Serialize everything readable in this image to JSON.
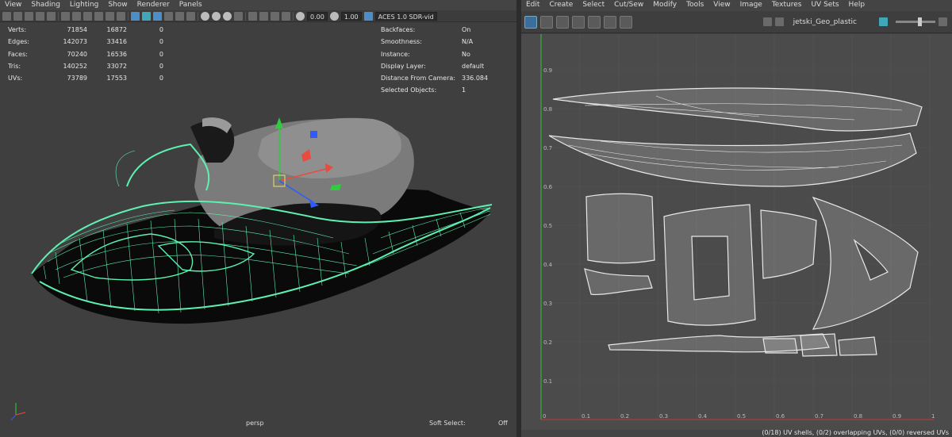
{
  "viewport": {
    "menus": [
      "View",
      "Shading",
      "Lighting",
      "Show",
      "Renderer",
      "Panels"
    ],
    "toolbar": {
      "field_a": "0.00",
      "field_b": "1.00",
      "colorspace": "ACES 1.0 SDR-vid"
    },
    "hud_stats": [
      {
        "label": "Verts:",
        "v1": "71854",
        "v2": "16872",
        "v3": "0"
      },
      {
        "label": "Edges:",
        "v1": "142073",
        "v2": "33416",
        "v3": "0"
      },
      {
        "label": "Faces:",
        "v1": "70240",
        "v2": "16536",
        "v3": "0"
      },
      {
        "label": "Tris:",
        "v1": "140252",
        "v2": "33072",
        "v3": "0"
      },
      {
        "label": "UVs:",
        "v1": "73789",
        "v2": "17553",
        "v3": "0"
      }
    ],
    "hud_info": [
      {
        "label": "Backfaces:",
        "value": "On"
      },
      {
        "label": "Smoothness:",
        "value": "N/A"
      },
      {
        "label": "Instance:",
        "value": "No"
      },
      {
        "label": "Display Layer:",
        "value": "default"
      },
      {
        "label": "Distance From Camera:",
        "value": "336.084"
      },
      {
        "label": "Selected Objects:",
        "value": "1"
      }
    ],
    "camera": "persp",
    "soft_select_label": "Soft Select:",
    "soft_select_value": "Off",
    "wire_color": "#5ef0b0",
    "icons": [
      "grid-icon",
      "camera-icon",
      "light-icon",
      "shaded-icon",
      "wireframe-icon"
    ]
  },
  "uv_editor": {
    "menus": [
      "Edit",
      "Create",
      "Select",
      "Cut/Sew",
      "Modify",
      "Tools",
      "View",
      "Image",
      "Textures",
      "UV Sets",
      "Help"
    ],
    "uv_set": "jetski_Geo_plastic",
    "v_ticks": [
      "0.9",
      "0.8",
      "0.7",
      "0.6",
      "0.5",
      "0.4",
      "0.3",
      "0.2",
      "0.1"
    ],
    "u_ticks": [
      "0",
      "0.1",
      "0.2",
      "0.3",
      "0.4",
      "0.5",
      "0.6",
      "0.7",
      "0.8",
      "0.9",
      "1"
    ],
    "status": "(0/18) UV shells, (0/2) overlapping UVs, (0/0) reversed UVs",
    "accent_v_axis": "#39c239",
    "accent_u_axis": "#c23939"
  }
}
